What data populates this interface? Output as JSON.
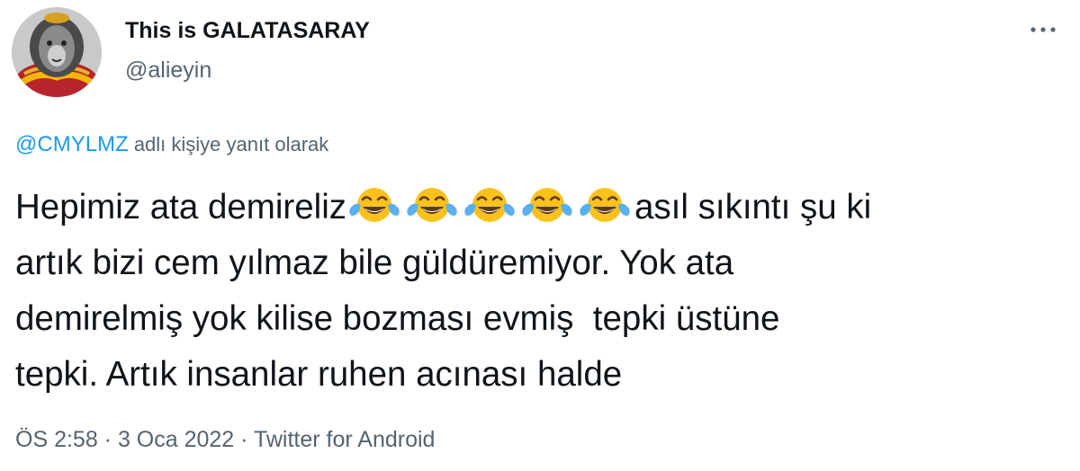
{
  "author": {
    "name": "This is GALATASARAY",
    "handle": "@alieyin",
    "avatar_icon": "lion-avatar"
  },
  "more_icon": "more-horizontal-icon",
  "reply": {
    "mention": "@CMYLMZ",
    "suffix": " adlı kişiye yanıt olarak"
  },
  "tweet": {
    "text_part1": "Hepimiz ata demireliz",
    "emoji": "face-with-tears-of-joy",
    "emoji_count": 5,
    "text_part2": "asıl sıkıntı şu ki\nartık bizi cem yılmaz bile güldüremiyor. Yok ata\ndemirelmiş yok kilise bozması evmiş  tepki üstüne\ntepki. Artık insanlar ruhen acınası halde"
  },
  "meta": {
    "time": "ÖS 2:58",
    "separator": " · ",
    "date": "3 Oca 2022",
    "source": "Twitter for Android"
  },
  "colors": {
    "text": "#0f1419",
    "secondary": "#536471",
    "link": "#1d9bf0",
    "background": "#ffffff"
  }
}
